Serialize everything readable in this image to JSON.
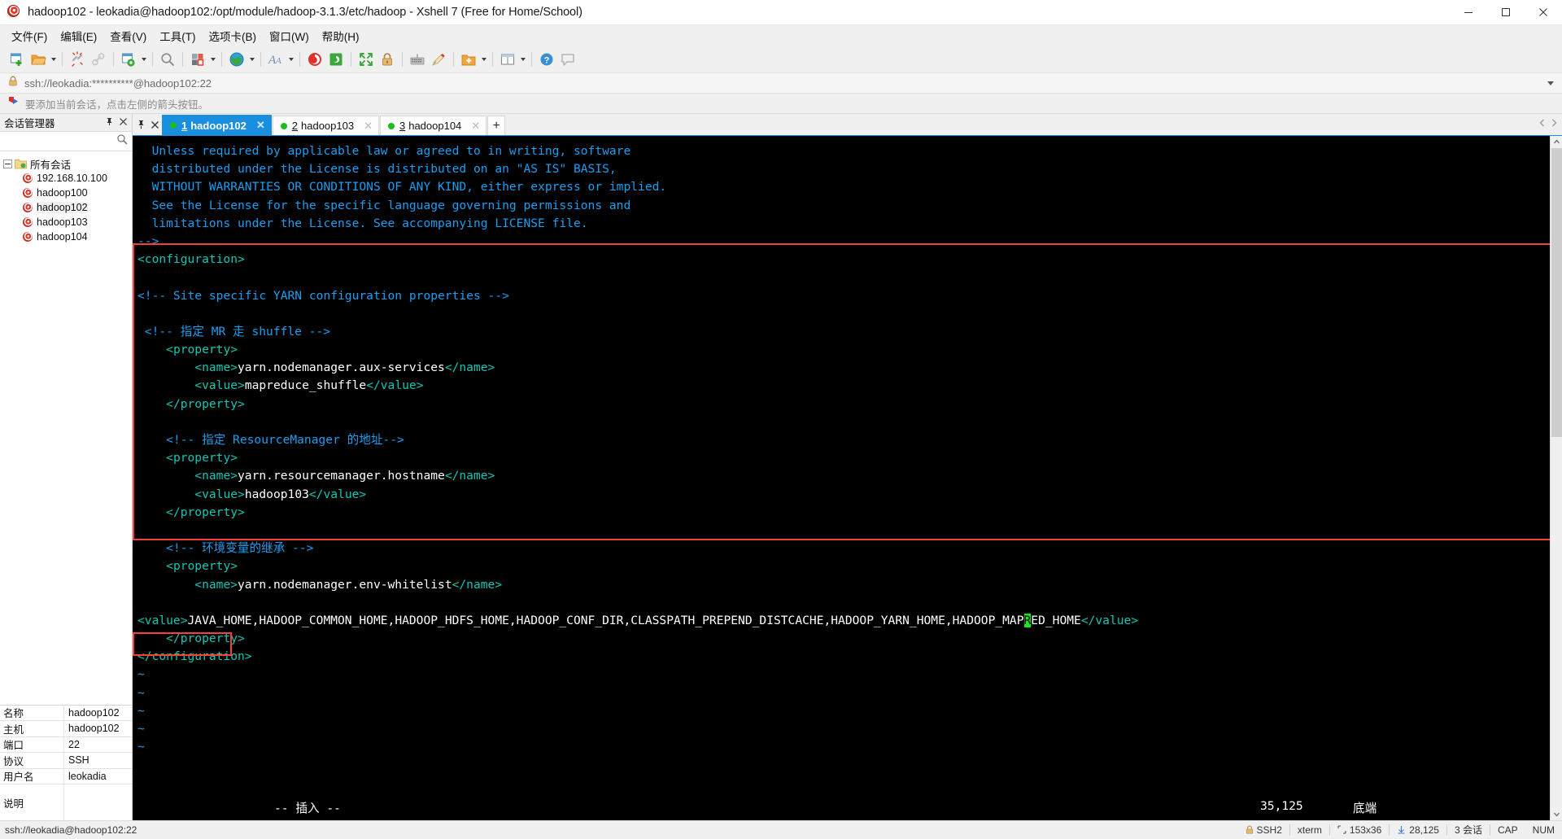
{
  "window": {
    "title": "hadoop102 - leokadia@hadoop102:/opt/module/hadoop-3.1.3/etc/hadoop - Xshell 7 (Free for Home/School)",
    "app_icon": "xshell-spiral-icon",
    "minimize_label": "Minimize",
    "maximize_label": "Maximize",
    "close_label": "Close"
  },
  "menubar": {
    "items": [
      {
        "label": "文件(F)",
        "name": "menu-file"
      },
      {
        "label": "编辑(E)",
        "name": "menu-edit"
      },
      {
        "label": "查看(V)",
        "name": "menu-view"
      },
      {
        "label": "工具(T)",
        "name": "menu-tools"
      },
      {
        "label": "选项卡(B)",
        "name": "menu-tab"
      },
      {
        "label": "窗口(W)",
        "name": "menu-window"
      },
      {
        "label": "帮助(H)",
        "name": "menu-help"
      }
    ]
  },
  "toolbar": {
    "icons": [
      "new-session-icon",
      "open-folder-icon",
      "disconnect-icon",
      "link-icon",
      "session-properties-icon",
      "find-icon",
      "transfer-icon",
      "globe-icon",
      "font-icon",
      "xshell-icon",
      "xftp-icon",
      "fullscreen-icon",
      "lock-icon",
      "keyboard-icon",
      "highlight-icon",
      "add-folder-icon",
      "layout-icon"
    ]
  },
  "addressbar": {
    "lock_icon": "lock-icon",
    "value": "ssh://leokadia:**********@hadoop102:22",
    "dropdown_icon": "chevron-down-icon"
  },
  "hintbar": {
    "icon": "arrow-flag-icon",
    "text": "要添加当前会话，点击左侧的箭头按钮。"
  },
  "sidebar": {
    "title": "会话管理器",
    "pin_icon": "pin-icon",
    "close_icon": "close-icon",
    "search_icon": "search-icon",
    "root": {
      "label": "所有会话",
      "icon": "folder-sessions-icon"
    },
    "items": [
      {
        "label": "192.168.10.100",
        "icon": "session-icon",
        "selected": false
      },
      {
        "label": "hadoop100",
        "icon": "session-icon",
        "selected": false
      },
      {
        "label": "hadoop102",
        "icon": "session-icon",
        "selected": true
      },
      {
        "label": "hadoop103",
        "icon": "session-icon",
        "selected": false
      },
      {
        "label": "hadoop104",
        "icon": "session-icon",
        "selected": false
      }
    ],
    "properties": [
      {
        "key": "名称",
        "value": "hadoop102"
      },
      {
        "key": "主机",
        "value": "hadoop102"
      },
      {
        "key": "端口",
        "value": "22"
      },
      {
        "key": "协议",
        "value": "SSH"
      },
      {
        "key": "用户名",
        "value": "leokadia"
      },
      {
        "key": "说明",
        "value": ""
      }
    ]
  },
  "tabs": {
    "pin_icon": "pin-icon",
    "close_icon": "close-icon",
    "items": [
      {
        "num": "1",
        "label": "hadoop102",
        "active": true
      },
      {
        "num": "2",
        "label": "hadoop103",
        "active": false
      },
      {
        "num": "3",
        "label": "hadoop104",
        "active": false
      }
    ],
    "add_label": "+"
  },
  "terminal": {
    "lines": [
      {
        "indent": 2,
        "segs": [
          {
            "t": "Unless required by applicable law or agreed to in writing, software",
            "c": "comment"
          }
        ]
      },
      {
        "indent": 2,
        "segs": [
          {
            "t": "distributed under the License is distributed on an \"AS IS\" BASIS,",
            "c": "comment"
          }
        ]
      },
      {
        "indent": 2,
        "segs": [
          {
            "t": "WITHOUT WARRANTIES OR CONDITIONS OF ANY KIND, either express or implied.",
            "c": "comment"
          }
        ]
      },
      {
        "indent": 2,
        "segs": [
          {
            "t": "See the License for the specific language governing permissions and",
            "c": "comment"
          }
        ]
      },
      {
        "indent": 2,
        "segs": [
          {
            "t": "limitations under the License. See accompanying LICENSE file.",
            "c": "comment"
          }
        ]
      },
      {
        "indent": 0,
        "segs": [
          {
            "t": "-->",
            "c": "comment"
          }
        ]
      },
      {
        "indent": 0,
        "segs": [
          {
            "t": "<configuration>",
            "c": "tag"
          }
        ]
      },
      {
        "indent": 0,
        "segs": [
          {
            "t": "",
            "c": "txt"
          }
        ]
      },
      {
        "indent": 0,
        "segs": [
          {
            "t": "<!-- Site specific YARN configuration properties -->",
            "c": "comment"
          }
        ]
      },
      {
        "indent": 0,
        "segs": [
          {
            "t": "",
            "c": "txt"
          }
        ]
      },
      {
        "indent": 1,
        "segs": [
          {
            "t": "<!-- 指定 MR 走 shuffle -->",
            "c": "comment"
          }
        ]
      },
      {
        "indent": 4,
        "segs": [
          {
            "t": "<property>",
            "c": "tag"
          }
        ]
      },
      {
        "indent": 8,
        "segs": [
          {
            "t": "<name>",
            "c": "tag"
          },
          {
            "t": "yarn.nodemanager.aux-services",
            "c": "txt"
          },
          {
            "t": "</name>",
            "c": "tag"
          }
        ]
      },
      {
        "indent": 8,
        "segs": [
          {
            "t": "<value>",
            "c": "tag"
          },
          {
            "t": "mapreduce_shuffle",
            "c": "txt"
          },
          {
            "t": "</value>",
            "c": "tag"
          }
        ]
      },
      {
        "indent": 4,
        "segs": [
          {
            "t": "</property>",
            "c": "tag"
          }
        ]
      },
      {
        "indent": 0,
        "segs": [
          {
            "t": "",
            "c": "txt"
          }
        ]
      },
      {
        "indent": 4,
        "segs": [
          {
            "t": "<!-- 指定 ResourceManager 的地址-->",
            "c": "comment"
          }
        ]
      },
      {
        "indent": 4,
        "segs": [
          {
            "t": "<property>",
            "c": "tag"
          }
        ]
      },
      {
        "indent": 8,
        "segs": [
          {
            "t": "<name>",
            "c": "tag"
          },
          {
            "t": "yarn.resourcemanager.hostname",
            "c": "txt"
          },
          {
            "t": "</name>",
            "c": "tag"
          }
        ]
      },
      {
        "indent": 8,
        "segs": [
          {
            "t": "<value>",
            "c": "tag"
          },
          {
            "t": "hadoop103",
            "c": "txt"
          },
          {
            "t": "</value>",
            "c": "tag"
          }
        ]
      },
      {
        "indent": 4,
        "segs": [
          {
            "t": "</property>",
            "c": "tag"
          }
        ]
      },
      {
        "indent": 0,
        "segs": [
          {
            "t": "",
            "c": "txt"
          }
        ]
      },
      {
        "indent": 4,
        "segs": [
          {
            "t": "<!-- 环境变量的继承 -->",
            "c": "comment"
          }
        ]
      },
      {
        "indent": 4,
        "segs": [
          {
            "t": "<property>",
            "c": "tag"
          }
        ]
      },
      {
        "indent": 8,
        "segs": [
          {
            "t": "<name>",
            "c": "tag"
          },
          {
            "t": "yarn.nodemanager.env-whitelist",
            "c": "txt"
          },
          {
            "t": "</name>",
            "c": "tag"
          }
        ]
      },
      {
        "indent": 0,
        "segs": [
          {
            "t": "",
            "c": "txt"
          }
        ]
      },
      {
        "indent": 0,
        "segs": [
          {
            "t": "<value>",
            "c": "tag"
          },
          {
            "t": "JAVA_HOME,HADOOP_COMMON_HOME,HADOOP_HDFS_HOME,HADOOP_CONF_DIR,CLASSPATH_PREPEND_DISTCACHE,HADOOP_YARN_HOME,HADOOP_MAP",
            "c": "txt"
          },
          {
            "t": "R",
            "c": "cursor"
          },
          {
            "t": "ED_HOME",
            "c": "txt"
          },
          {
            "t": "</value>",
            "c": "tag"
          }
        ]
      },
      {
        "indent": 4,
        "segs": [
          {
            "t": "</property>",
            "c": "tag"
          }
        ]
      },
      {
        "indent": 0,
        "segs": [
          {
            "t": "</configuration>",
            "c": "tag"
          }
        ]
      },
      {
        "indent": 0,
        "segs": [
          {
            "t": "~",
            "c": "tilde"
          }
        ]
      },
      {
        "indent": 0,
        "segs": [
          {
            "t": "~",
            "c": "tilde"
          }
        ]
      },
      {
        "indent": 0,
        "segs": [
          {
            "t": "~",
            "c": "tilde"
          }
        ]
      },
      {
        "indent": 0,
        "segs": [
          {
            "t": "~",
            "c": "tilde"
          }
        ]
      },
      {
        "indent": 0,
        "segs": [
          {
            "t": "~",
            "c": "tilde"
          }
        ]
      }
    ],
    "vim_status": {
      "mode": "-- 插入 --",
      "position": "35,125",
      "scroll": "底端"
    },
    "annotation_color": "#f4413b"
  },
  "statusbar": {
    "left": "ssh://leokadia@hadoop102:22",
    "cells": [
      {
        "icon": "lock-icon",
        "label": "SSH2",
        "name": "status-protocol"
      },
      {
        "icon": "",
        "label": "xterm",
        "name": "status-terminal-type"
      },
      {
        "icon": "size-icon",
        "label": "153x36",
        "name": "status-size"
      },
      {
        "icon": "bytes-icon",
        "label": "28,125",
        "name": "status-bytes"
      },
      {
        "icon": "",
        "label": "3 会话",
        "name": "status-sessions"
      },
      {
        "icon": "",
        "label": "CAP",
        "name": "status-caps"
      },
      {
        "icon": "",
        "label": "NUM",
        "name": "status-num"
      }
    ]
  }
}
